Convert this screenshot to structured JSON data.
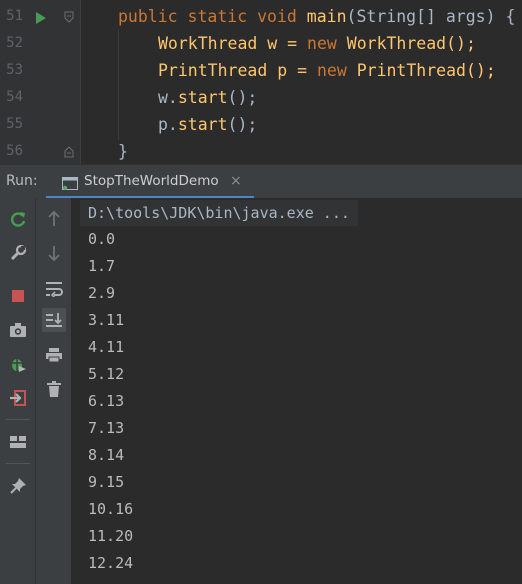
{
  "editor": {
    "lines": [
      {
        "num": "51"
      },
      {
        "num": "52"
      },
      {
        "num": "53"
      },
      {
        "num": "54"
      },
      {
        "num": "55"
      },
      {
        "num": "56"
      }
    ],
    "code": {
      "l51": {
        "kw1": "public",
        "kw2": "static",
        "kw3": "void",
        "fn": "main",
        "rest": "(String[] args) {"
      },
      "l52": {
        "t1": "WorkThread w = ",
        "kw": "new",
        "t2": " WorkThread();"
      },
      "l53": {
        "t1": "PrintThread p = ",
        "kw": "new",
        "t2": " PrintThread();"
      },
      "l54": {
        "obj": "w.",
        "fn": "start",
        "rest": "();"
      },
      "l55": {
        "obj": "p.",
        "fn": "start",
        "rest": "();"
      },
      "l56": {
        "text": "}"
      }
    }
  },
  "run_panel": {
    "label": "Run:",
    "tab_title": "StopTheWorldDemo",
    "tab_close": "×",
    "command": "D:\\tools\\JDK\\bin\\java.exe ...",
    "output": [
      "0.0",
      "1.7",
      "2.9",
      "3.11",
      "4.11",
      "5.12",
      "6.13",
      "7.13",
      "8.14",
      "9.15",
      "10.16",
      "11.20",
      "12.24"
    ]
  },
  "colors": {
    "keyword": "#cc7832",
    "method": "#ffc66d",
    "text": "#a9b7c6",
    "accent": "#4a88c7",
    "rerun": "#499c54",
    "stop": "#c75450"
  },
  "icons": {
    "left_bar": [
      "rerun-icon",
      "wrench-icon",
      "stop-icon",
      "camera-icon",
      "debug-bug-icon",
      "exit-icon",
      "layout-icon",
      "pin-icon"
    ],
    "mid_bar": [
      "arrow-up-icon",
      "arrow-down-icon",
      "soft-wrap-icon",
      "scroll-to-end-icon",
      "print-icon",
      "trash-icon"
    ]
  }
}
